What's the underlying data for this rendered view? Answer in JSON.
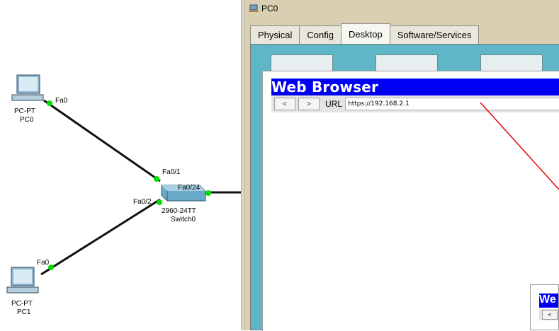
{
  "topology": {
    "pc0": {
      "type_label": "PC-PT",
      "name_label": "PC0",
      "port_label": "Fa0"
    },
    "pc1": {
      "type_label": "PC-PT",
      "name_label": "PC1",
      "port_label": "Fa0"
    },
    "switch": {
      "type_label": "2960-24TT",
      "name_label": "Switch0",
      "ports": [
        "Fa0/1",
        "Fa0/24",
        "Fa0/2"
      ]
    }
  },
  "pc_window": {
    "title": "PC0",
    "tabs": [
      {
        "label": "Physical",
        "active": false
      },
      {
        "label": "Config",
        "active": false
      },
      {
        "label": "Desktop",
        "active": true
      },
      {
        "label": "Software/Services",
        "active": false
      }
    ]
  },
  "web_browser": {
    "title": "Web Browser",
    "back_label": "<",
    "forward_label": ">",
    "url_label": "URL",
    "url_value": "https://192.168.2.1"
  },
  "mini_browser": {
    "title": "We",
    "back_label": "<"
  },
  "colors": {
    "browser_title_bar": "#0000f4",
    "desktop_background": "#5fb6c7",
    "link_active": "#00e000",
    "annotation": "#e00000"
  }
}
